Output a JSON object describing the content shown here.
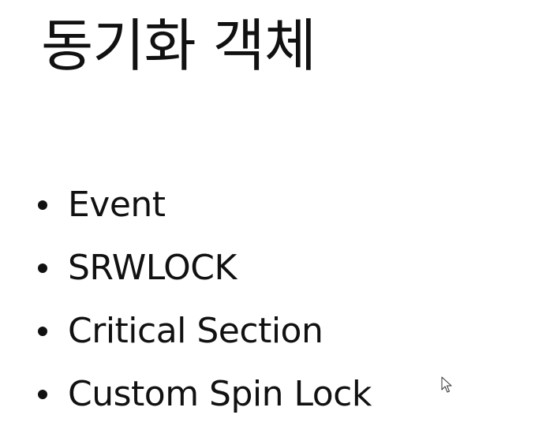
{
  "slide": {
    "title": "동기화 객체",
    "bullets": [
      "Event",
      "SRWLOCK",
      "Critical Section",
      "Custom Spin Lock"
    ]
  },
  "icons": {
    "cursor": "mouse-cursor-icon"
  }
}
